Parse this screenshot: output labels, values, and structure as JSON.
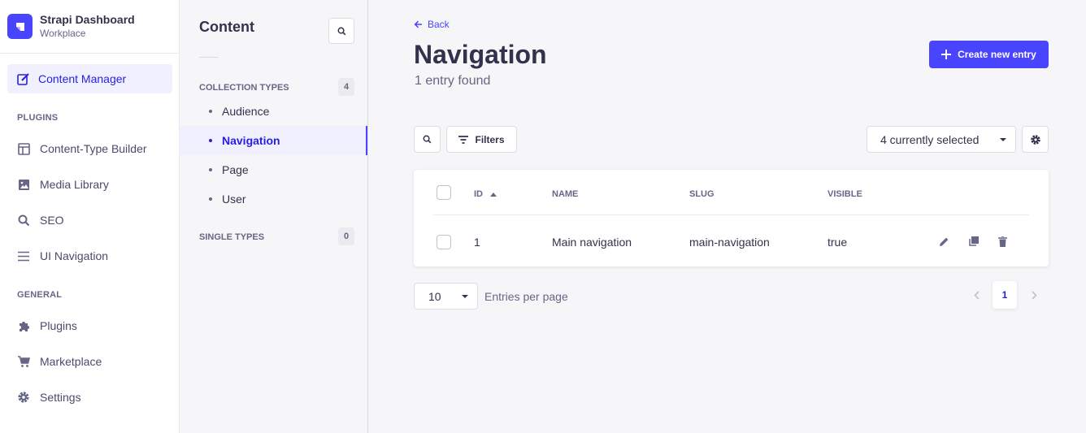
{
  "brand": {
    "title": "Strapi Dashboard",
    "subtitle": "Workplace"
  },
  "sidebar": {
    "active": {
      "label": "Content Manager",
      "icon": "feather-icon"
    },
    "plugins_heading": "PLUGINS",
    "plugins": [
      {
        "label": "Content-Type Builder",
        "icon": "layout-icon"
      },
      {
        "label": "Media Library",
        "icon": "image-icon"
      },
      {
        "label": "SEO",
        "icon": "search-icon"
      },
      {
        "label": "UI Navigation",
        "icon": "list-icon"
      }
    ],
    "general_heading": "GENERAL",
    "general": [
      {
        "label": "Plugins",
        "icon": "puzzle-icon"
      },
      {
        "label": "Marketplace",
        "icon": "cart-icon"
      },
      {
        "label": "Settings",
        "icon": "gear-icon"
      }
    ]
  },
  "subnav": {
    "title": "Content",
    "collection_heading": "COLLECTION TYPES",
    "collection_count": "4",
    "collection_items": [
      "Audience",
      "Navigation",
      "Page",
      "User"
    ],
    "active_item": "Navigation",
    "single_heading": "SINGLE TYPES",
    "single_count": "0"
  },
  "main": {
    "back_label": "Back",
    "title": "Navigation",
    "subtitle": "1 entry found",
    "create_label": "Create new entry",
    "filters_label": "Filters",
    "columns_select": "4 currently selected",
    "table": {
      "headers": [
        "ID",
        "NAME",
        "SLUG",
        "VISIBLE"
      ],
      "rows": [
        {
          "id": "1",
          "name": "Main navigation",
          "slug": "main-navigation",
          "visible": "true"
        }
      ]
    },
    "page_size": "10",
    "entries_per_page": "Entries per page",
    "current_page": "1"
  },
  "colors": {
    "primary": "#4945ff",
    "active_bg": "#f0f0ff",
    "active_text": "#271fe0",
    "background": "#f6f6f9"
  }
}
